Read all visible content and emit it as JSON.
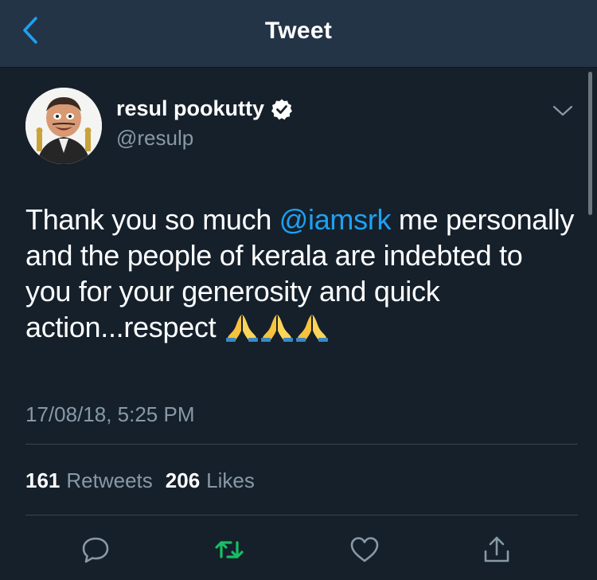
{
  "header": {
    "title": "Tweet",
    "back_icon": "chevron-left-icon"
  },
  "tweet": {
    "author": {
      "display_name": "resul pookutty",
      "handle": "@resulp",
      "verified": true
    },
    "text_before_mention": "Thank you so much ",
    "mention": "@iamsrk",
    "text_after_mention": " me personally and the people of kerala are indebted to you for your generosity and quick action...respect ",
    "emoji": [
      "folded-hands-icon",
      "folded-hands-icon",
      "folded-hands-icon"
    ],
    "timestamp": "17/08/18, 5:25 PM"
  },
  "stats": {
    "retweets_count": "161",
    "retweets_label": "Retweets",
    "likes_count": "206",
    "likes_label": "Likes"
  },
  "actions": [
    "reply-icon",
    "retweet-icon",
    "like-icon",
    "share-icon"
  ],
  "colors": {
    "background": "#15202b",
    "header": "#243447",
    "accent": "#1da1f2",
    "secondary_text": "#8899a6",
    "retweeted": "#17bf63",
    "divider": "#38444d"
  }
}
